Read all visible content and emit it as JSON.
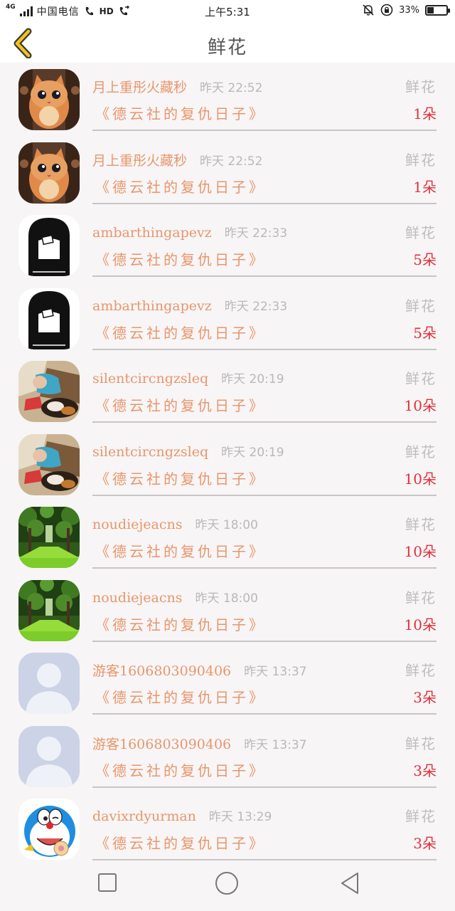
{
  "status_bar": {
    "network": "4G",
    "carrier": "中国电信",
    "hd": "HD",
    "time": "上午5:31",
    "battery": "33%",
    "battery_level": 0.33
  },
  "header": {
    "title": "鲜花",
    "back_icon": "chevron-left-icon"
  },
  "colors": {
    "username": "#e8966b",
    "book": "#e8966b",
    "quantity": "#e0303b",
    "muted": "#bdbdbd",
    "divider": "#c9c5c7"
  },
  "items": [
    {
      "avatar": "cat",
      "user": "月上重彤火藏秒",
      "time": "昨天 22:52",
      "gift": "鲜花",
      "book": "《德云社的复仇日子》",
      "qty": "1朵"
    },
    {
      "avatar": "cat",
      "user": "月上重彤火藏秒",
      "time": "昨天 22:52",
      "gift": "鲜花",
      "book": "《德云社的复仇日子》",
      "qty": "1朵"
    },
    {
      "avatar": "girl",
      "user": "ambarthingapevz",
      "time": "昨天 22:33",
      "gift": "鲜花",
      "book": "《德云社的复仇日子》",
      "qty": "5朵"
    },
    {
      "avatar": "girl",
      "user": "ambarthingapevz",
      "time": "昨天 22:33",
      "gift": "鲜花",
      "book": "《德云社的复仇日子》",
      "qty": "5朵"
    },
    {
      "avatar": "sleeping",
      "user": "silentcircngzsleq",
      "time": "昨天 20:19",
      "gift": "鲜花",
      "book": "《德云社的复仇日子》",
      "qty": "10朵"
    },
    {
      "avatar": "sleeping",
      "user": "silentcircngzsleq",
      "time": "昨天 20:19",
      "gift": "鲜花",
      "book": "《德云社的复仇日子》",
      "qty": "10朵"
    },
    {
      "avatar": "forest",
      "user": "noudiejeacns",
      "time": "昨天 18:00",
      "gift": "鲜花",
      "book": "《德云社的复仇日子》",
      "qty": "10朵"
    },
    {
      "avatar": "forest",
      "user": "noudiejeacns",
      "time": "昨天 18:00",
      "gift": "鲜花",
      "book": "《德云社的复仇日子》",
      "qty": "10朵"
    },
    {
      "avatar": "default",
      "user": "游客1606803090406",
      "time": "昨天 13:37",
      "gift": "鲜花",
      "book": "《德云社的复仇日子》",
      "qty": "3朵"
    },
    {
      "avatar": "default",
      "user": "游客1606803090406",
      "time": "昨天 13:37",
      "gift": "鲜花",
      "book": "《德云社的复仇日子》",
      "qty": "3朵"
    },
    {
      "avatar": "doraemon",
      "user": "davixrdyurman",
      "time": "昨天 13:29",
      "gift": "鲜花",
      "book": "《德云社的复仇日子》",
      "qty": "3朵"
    }
  ],
  "nav": {
    "recent_icon": "square-icon",
    "home_icon": "circle-icon",
    "back_icon": "triangle-back-icon"
  }
}
